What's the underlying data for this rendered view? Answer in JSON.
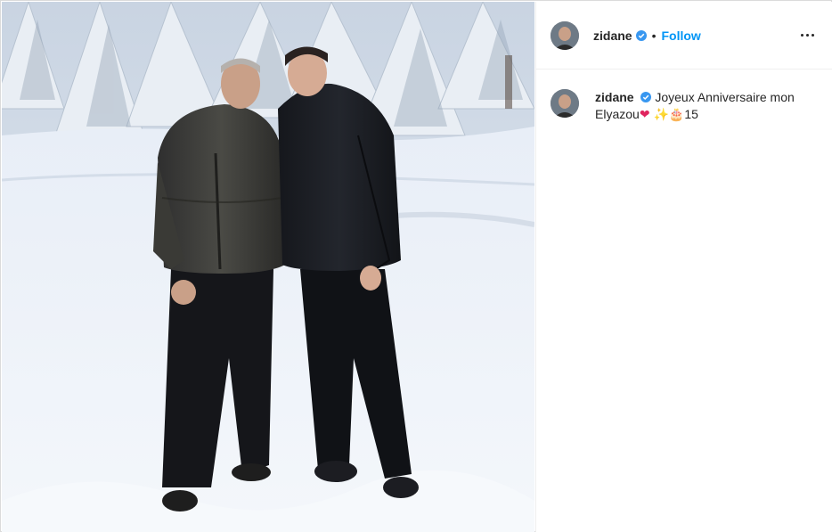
{
  "post": {
    "username": "zidane",
    "verified": true,
    "separator": "•",
    "follow_label": "Follow",
    "more_icon": "more-horizontal-icon",
    "caption": {
      "username": "zidane",
      "text_line1": "Joyeux Anniversaire mon",
      "text_line2": "Elyazou",
      "emojis": "❤️🎂",
      "sparkle_emoji": "✨",
      "cake_emoji": "🎂",
      "heart_emoji": "❤",
      "number": "15"
    }
  },
  "colors": {
    "follow": "#0095f6",
    "verified": "#3897f0",
    "text": "#262626",
    "border": "#efefef"
  }
}
